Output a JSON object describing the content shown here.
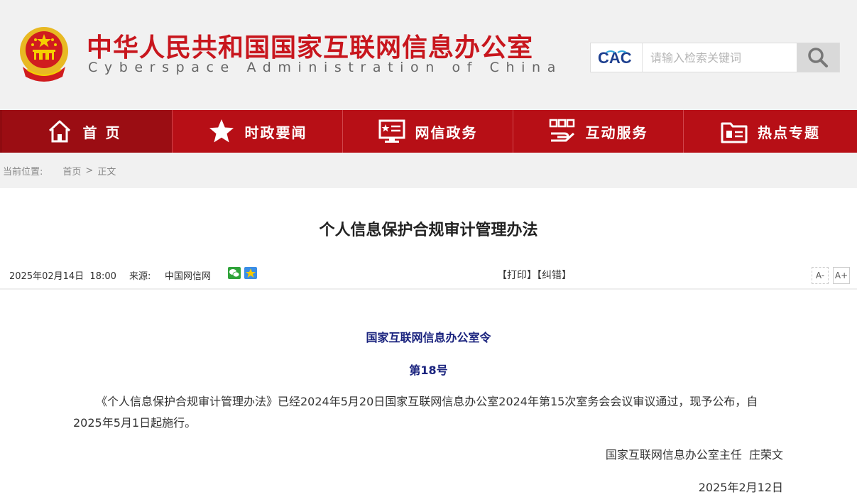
{
  "header": {
    "title": "中华人民共和国国家互联网信息办公室",
    "subtitle": "Cyberspace Administration of China",
    "logo_text": "CAC",
    "search_placeholder": "请输入检索关键词"
  },
  "nav": {
    "items": [
      {
        "label": "首页",
        "icon": "home-icon"
      },
      {
        "label": "时政要闻",
        "icon": "star-icon"
      },
      {
        "label": "网信政务",
        "icon": "government-affairs-icon"
      },
      {
        "label": "互动服务",
        "icon": "interactive-service-icon"
      },
      {
        "label": "热点专题",
        "icon": "folder-topics-icon"
      }
    ]
  },
  "breadcrumb": {
    "label": "当前位置:",
    "home": "首页",
    "separator": ">",
    "current": "正文"
  },
  "article": {
    "title": "个人信息保护合规审计管理办法",
    "date": "2025年02月14日  18:00",
    "source_label": "来源:",
    "source": "中国网信网",
    "print": "【打印】",
    "correct": "【纠错】",
    "font_small": "A-",
    "font_large": "A+",
    "order_title": "国家互联网信息办公室令",
    "order_no": "第18号",
    "paragraph": "《个人信息保护合规审计管理办法》已经2024年5月20日国家互联网信息办公室2024年第15次室务会会议审议通过，现予公布，自2025年5月1日起施行。",
    "signature": "国家互联网信息办公室主任  庄荣文",
    "sign_date": "2025年2月12日"
  },
  "colors": {
    "brand_red": "#c8161d",
    "nav_red": "#b70f16",
    "order_blue": "#1a237e"
  }
}
